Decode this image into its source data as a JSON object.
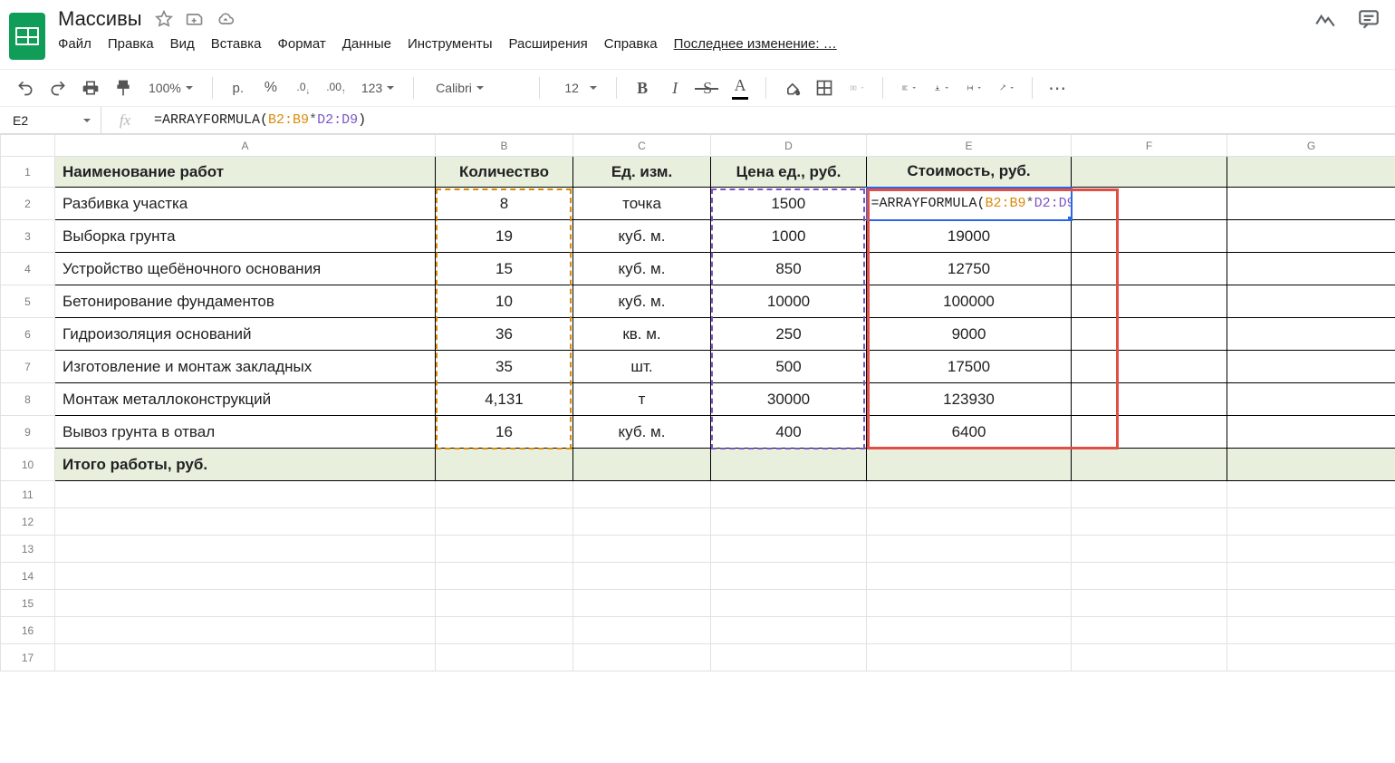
{
  "doc": {
    "title": "Массивы"
  },
  "menu": {
    "file": "Файл",
    "edit": "Правка",
    "view": "Вид",
    "insert": "Вставка",
    "format": "Формат",
    "data": "Данные",
    "tools": "Инструменты",
    "extensions": "Расширения",
    "help": "Справка",
    "last_edit": "Последнее изменение: …"
  },
  "toolbar": {
    "zoom": "100%",
    "currency": "р.",
    "percent": "%",
    "dec_less": ".0",
    "dec_more": ".00",
    "num_fmt": "123",
    "font": "Calibri",
    "size": "12"
  },
  "namebox": "E2",
  "fx_label": "fx",
  "formula": {
    "prefix": "=ARRAYFORMULA(",
    "r1": "B2:B9",
    "op": "*",
    "r2": "D2:D9",
    "suffix": ")"
  },
  "columns": [
    "A",
    "B",
    "C",
    "D",
    "E",
    "F",
    "G"
  ],
  "row_numbers": [
    "1",
    "2",
    "3",
    "4",
    "5",
    "6",
    "7",
    "8",
    "9",
    "10",
    "11",
    "12",
    "13",
    "14",
    "15",
    "16",
    "17"
  ],
  "headers": {
    "name": "Наименование работ",
    "qty": "Количество",
    "unit": "Ед. изм.",
    "price": "Цена ед., руб.",
    "cost": "Стоимость, руб."
  },
  "rows": [
    {
      "name": "Разбивка участка",
      "qty": "8",
      "unit": "точка",
      "price": "1500",
      "cost": ""
    },
    {
      "name": "Выборка грунта",
      "qty": "19",
      "unit": "куб. м.",
      "price": "1000",
      "cost": "19000"
    },
    {
      "name": "Устройство щебёночного основания",
      "qty": "15",
      "unit": "куб. м.",
      "price": "850",
      "cost": "12750"
    },
    {
      "name": "Бетонирование фундаментов",
      "qty": "10",
      "unit": "куб. м.",
      "price": "10000",
      "cost": "100000"
    },
    {
      "name": "Гидроизоляция оснований",
      "qty": "36",
      "unit": "кв. м.",
      "price": "250",
      "cost": "9000"
    },
    {
      "name": "Изготовление и монтаж закладных",
      "qty": "35",
      "unit": "шт.",
      "price": "500",
      "cost": "17500"
    },
    {
      "name": "Монтаж металлоконструкций",
      "qty": "4,131",
      "unit": "т",
      "price": "30000",
      "cost": "123930"
    },
    {
      "name": "Вывоз грунта в отвал",
      "qty": "16",
      "unit": "куб. м.",
      "price": "400",
      "cost": "6400"
    }
  ],
  "total_label": "Итого работы, руб."
}
